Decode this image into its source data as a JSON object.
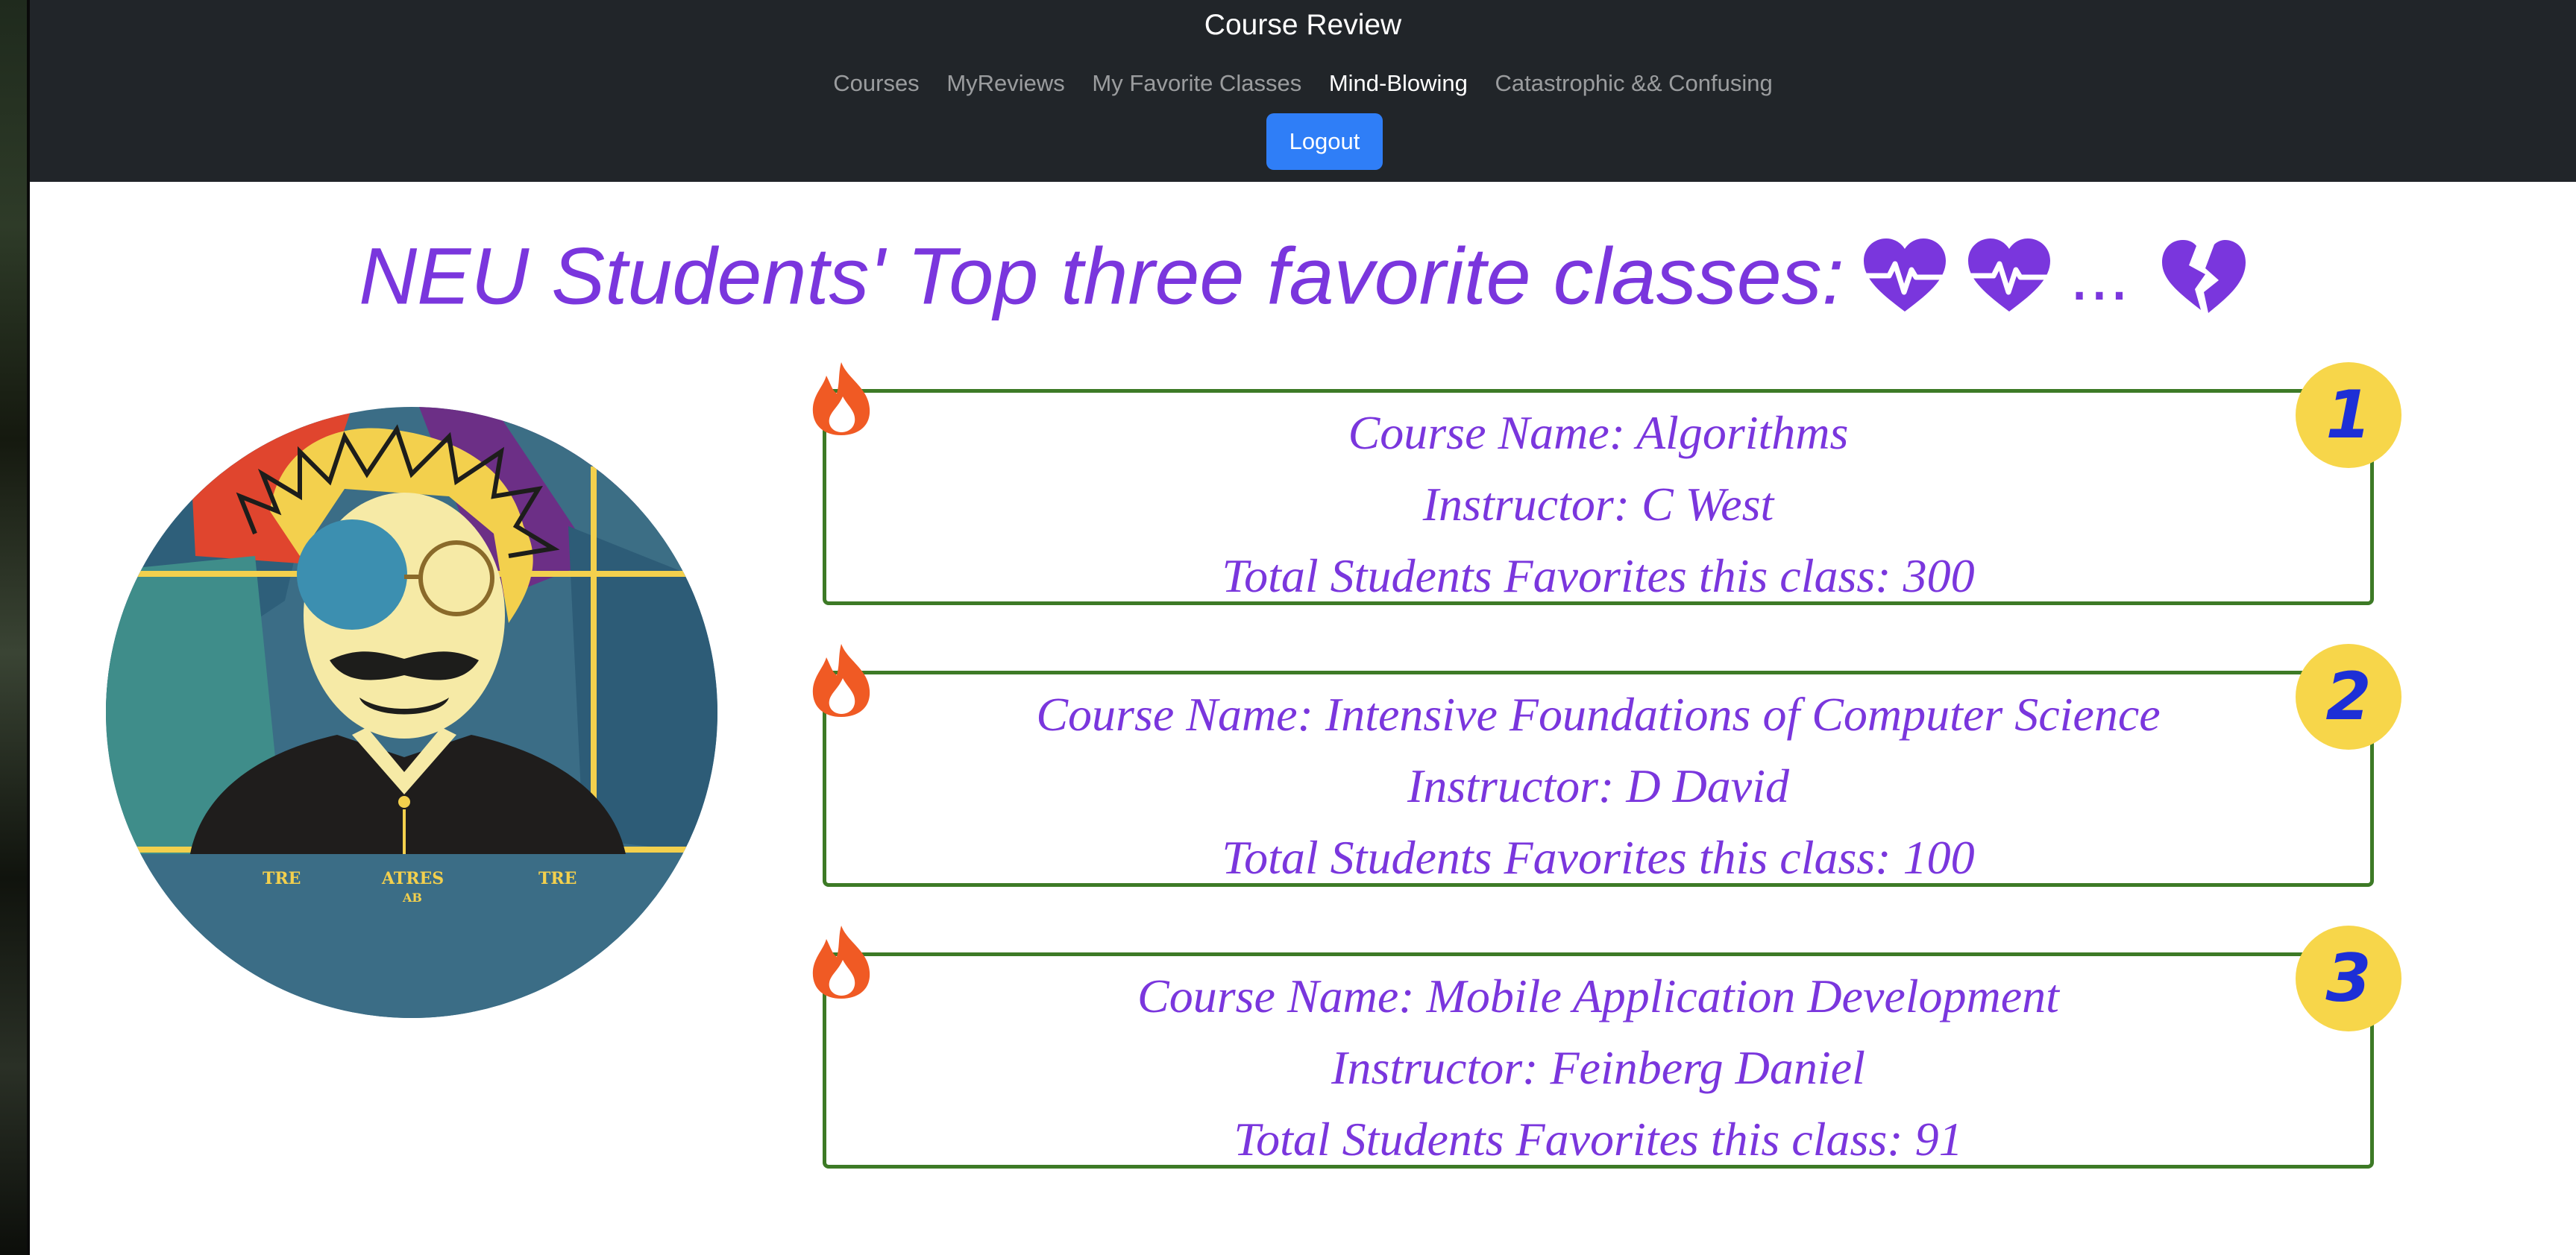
{
  "navbar": {
    "brand": "Course Review",
    "links": [
      {
        "label": "Courses",
        "active": false
      },
      {
        "label": "MyReviews",
        "active": false
      },
      {
        "label": "My Favorite Classes",
        "active": false
      },
      {
        "label": "Mind-Blowing",
        "active": true
      },
      {
        "label": "Catastrophic && Confusing",
        "active": false
      }
    ],
    "logout_label": "Logout"
  },
  "heading": {
    "text": "NEU Students' Top three favorite classes:",
    "ellipsis": "...",
    "icons": [
      "heartbeat-icon",
      "heartbeat-icon",
      "broken-heart-icon"
    ]
  },
  "portrait": {
    "icon": "einstein-portrait",
    "caption_words": [
      "TRE",
      "ATRES",
      "TRE",
      "AB"
    ]
  },
  "colors": {
    "accent": "#7a36dd",
    "navbar": "#212529",
    "button": "#2f7ef7",
    "card_border": "#3d7a26",
    "badge": "#f7d64a",
    "badge_text": "#1d2fd6",
    "fire": "#f05a24"
  },
  "courses": [
    {
      "rank": "1",
      "name_line": "Course Name: Algorithms",
      "instructor_line": "Instructor: C West",
      "favorites_line": "Total Students Favorites this class: 300"
    },
    {
      "rank": "2",
      "name_line": "Course Name: Intensive Foundations of Computer Science",
      "instructor_line": "Instructor: D David",
      "favorites_line": "Total Students Favorites this class: 100"
    },
    {
      "rank": "3",
      "name_line": "Course Name: Mobile Application Development",
      "instructor_line": "Instructor: Feinberg Daniel",
      "favorites_line": "Total Students Favorites this class: 91"
    }
  ]
}
